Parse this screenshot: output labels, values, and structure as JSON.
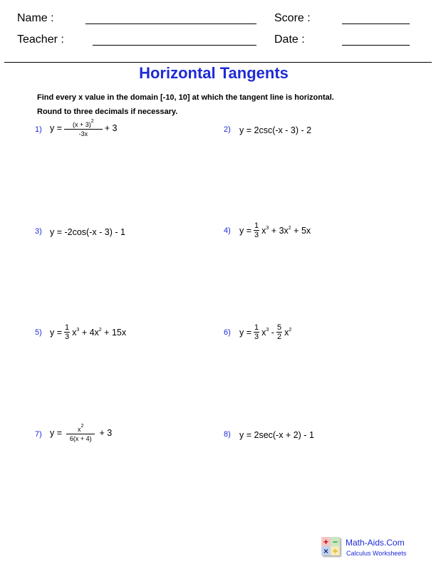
{
  "header": {
    "name_label": "Name :",
    "teacher_label": "Teacher :",
    "score_label": "Score :",
    "date_label": "Date :"
  },
  "title": "Horizontal Tangents",
  "instructions": [
    "Find every x value in the domain [-10, 10] at which the tangent line is horizontal.",
    "Round to three decimals if necessary."
  ],
  "problems": [
    {
      "number": "1)",
      "lhs": "y =",
      "num": "(x + 3)",
      "num_exp": "2",
      "den": "-3x",
      "tail": "+ 3"
    },
    {
      "number": "2)",
      "text": "y = 2csc(-x - 3) - 2"
    },
    {
      "number": "3)",
      "text": "y = -2cos(-x - 3) - 1"
    },
    {
      "number": "4)",
      "lhs": "y =",
      "frac_num": "1",
      "frac_den": "3",
      "t1": "x",
      "e1": "3",
      "t2": "+ 3x",
      "e2": "2",
      "t3": "+ 5x"
    },
    {
      "number": "5)",
      "lhs": "y =",
      "frac_num": "1",
      "frac_den": "3",
      "t1": "x",
      "e1": "3",
      "t2": "+ 4x",
      "e2": "2",
      "t3": "+ 15x"
    },
    {
      "number": "6)",
      "lhs": "y =",
      "frac_num": "1",
      "frac_den": "3",
      "t1": "x",
      "e1": "3",
      "mid": "-",
      "frac2_num": "5",
      "frac2_den": "2",
      "t2": "x",
      "e2": "2"
    },
    {
      "number": "7)",
      "lhs": "y =",
      "num": "x",
      "num_exp": "2",
      "den": "6(x + 4)",
      "tail": "+ 3"
    },
    {
      "number": "8)",
      "text": "y = 2sec(-x + 2) - 1"
    }
  ],
  "footer": {
    "brand": "Math-Aids.Com",
    "subtitle": "Calculus Worksheets",
    "logo_symbols": [
      "+",
      "−",
      "×",
      "÷"
    ]
  }
}
